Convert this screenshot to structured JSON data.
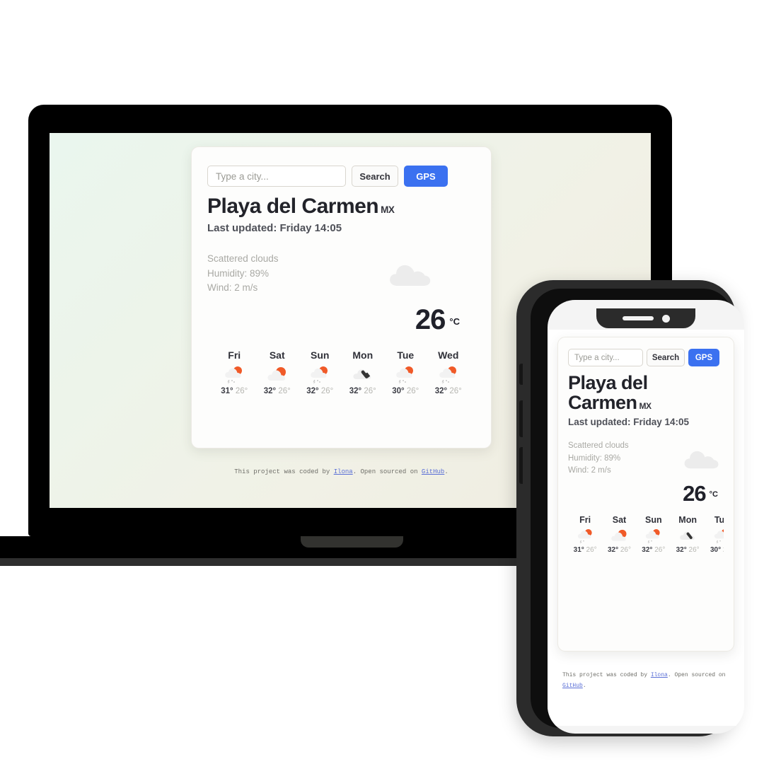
{
  "app": {
    "search": {
      "placeholder": "Type a city...",
      "value": "",
      "search_label": "Search",
      "gps_label": "GPS"
    },
    "location": {
      "city": "Playa del Carmen",
      "country_code": "MX",
      "last_updated": "Last updated: Friday 14:05"
    },
    "current": {
      "condition": "Scattered clouds",
      "humidity": "Humidity: 89%",
      "wind": "Wind: 2 m/s",
      "temperature": "26",
      "unit": "°C",
      "icon": "cloud-icon"
    },
    "forecast": [
      {
        "day": "Fri",
        "icon": "sun-cloud-drizzle-icon",
        "max": "31°",
        "min": "26°"
      },
      {
        "day": "Sat",
        "icon": "sun-cloud-icon",
        "max": "32°",
        "min": "26°"
      },
      {
        "day": "Sun",
        "icon": "sun-cloud-drizzle-icon",
        "max": "32°",
        "min": "26°"
      },
      {
        "day": "Mon",
        "icon": "cloud-lightning-icon",
        "max": "32°",
        "min": "26°"
      },
      {
        "day": "Tue",
        "icon": "sun-cloud-drizzle-icon",
        "max": "30°",
        "min": "26°"
      },
      {
        "day": "Wed",
        "icon": "sun-cloud-drizzle-icon",
        "max": "32°",
        "min": "26°"
      }
    ],
    "footer": {
      "text_before": "This project was coded by ",
      "author_link": "Ilona",
      "text_middle": ". Open sourced on ",
      "source_link": "GitHub",
      "text_after": "."
    }
  },
  "colors": {
    "gps_blue": "#3b71f0",
    "card_bg": "#fdfdfc",
    "screen_gradient_start": "#eaf6ee",
    "screen_gradient_end": "#efece0",
    "device_frame": "#2b2b2b",
    "link": "#5a6fd6"
  }
}
